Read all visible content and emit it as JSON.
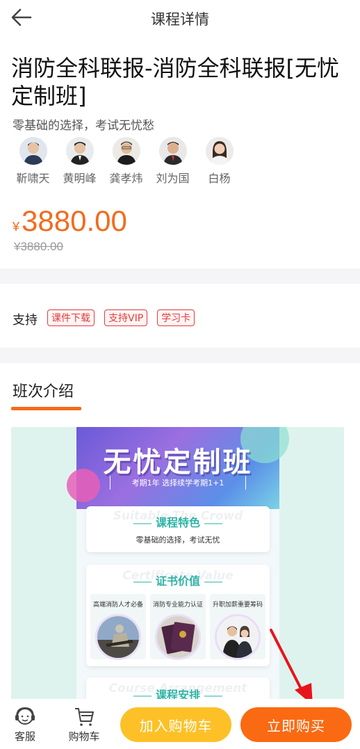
{
  "header": {
    "title": "课程详情"
  },
  "course": {
    "title": "消防全科联报-消防全科联报[无忧定制班]",
    "subtitle": "零基础的选择，考试无忧愁",
    "teachers": [
      "靳啸天",
      "黄明峰",
      "龚孝炜",
      "刘为国",
      "白杨"
    ],
    "currency": "¥",
    "price": "3880.00",
    "original_price": "¥3880.00"
  },
  "support": {
    "label": "支持",
    "tags": [
      "课件下载",
      "支持VIP",
      "学习卡"
    ]
  },
  "section": {
    "title": "班次介绍"
  },
  "poster": {
    "title": "无忧定制班",
    "subtitle": "考期1年 选择续学考期1+1",
    "card1": {
      "bg_text": "Suitable The Crowd",
      "heading": "课程特色",
      "body": "零基础的选择，考试无忧"
    },
    "card2": {
      "bg_text": "Certificate Value",
      "heading": "证书价值",
      "items": [
        "高端消防人才必备",
        "消防专业能力认证",
        "升职加薪重要筹码"
      ]
    },
    "card3": {
      "bg_text": "Course Arrangement",
      "heading": "课程安排"
    }
  },
  "bottom_bar": {
    "service_label": "客服",
    "cart_label": "购物车",
    "add_to_cart": "加入购物车",
    "buy_now": "立即购买"
  },
  "colors": {
    "accent": "#f26b1d",
    "tag_red": "#e23c3c",
    "cart_button": "#fdc127",
    "buy_button": "#fa6a12",
    "poster_teal": "#2eb3a6"
  },
  "icons": [
    "back-arrow-icon",
    "customer-service-icon",
    "shopping-cart-icon",
    "red-arrow-annotation"
  ]
}
